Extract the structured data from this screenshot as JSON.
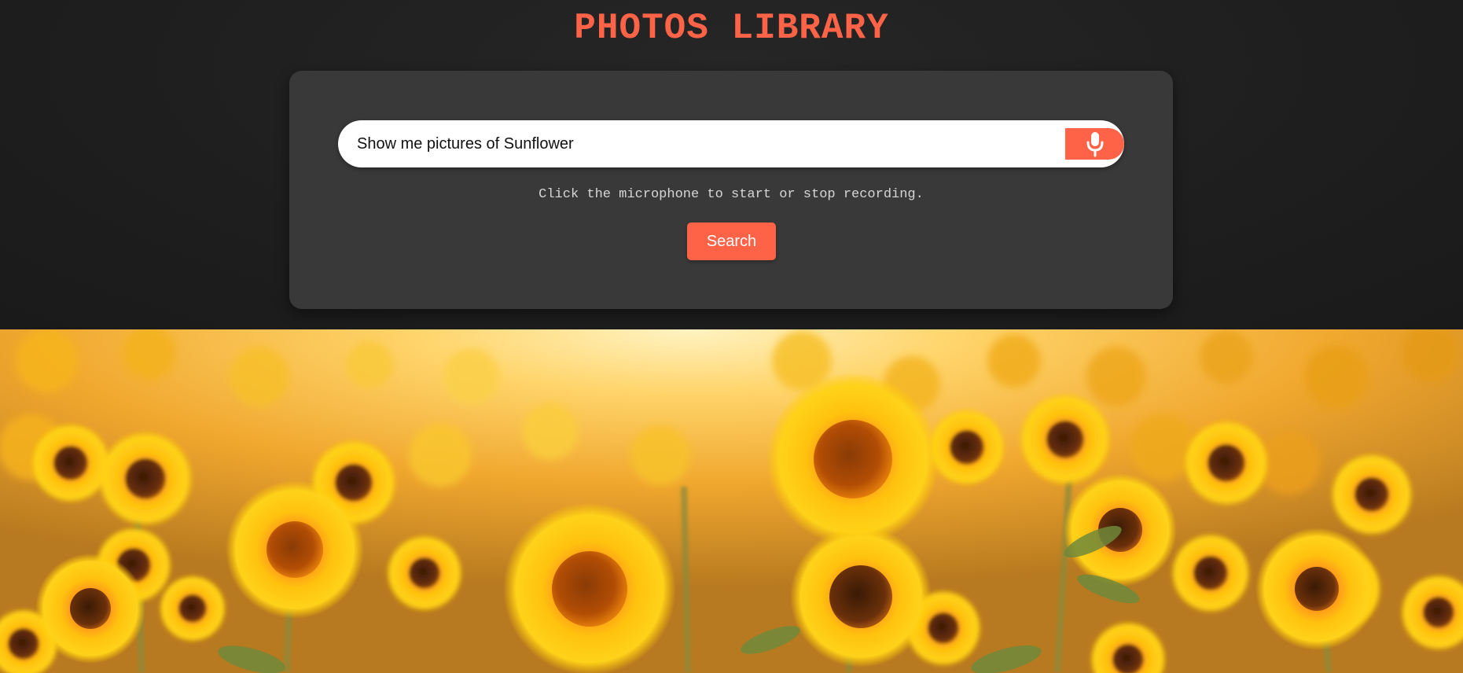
{
  "header": {
    "title": "PHOTOS LIBRARY"
  },
  "search": {
    "query": "Show me pictures of Sunflower",
    "mic_icon": "microphone-icon",
    "hint": "Click the microphone to start or stop recording.",
    "button_label": "Search"
  },
  "result": {
    "subject": "sunflower field photo"
  },
  "colors": {
    "accent": "#ff6347",
    "background": "#1c1c1c",
    "panel": "#393939"
  }
}
